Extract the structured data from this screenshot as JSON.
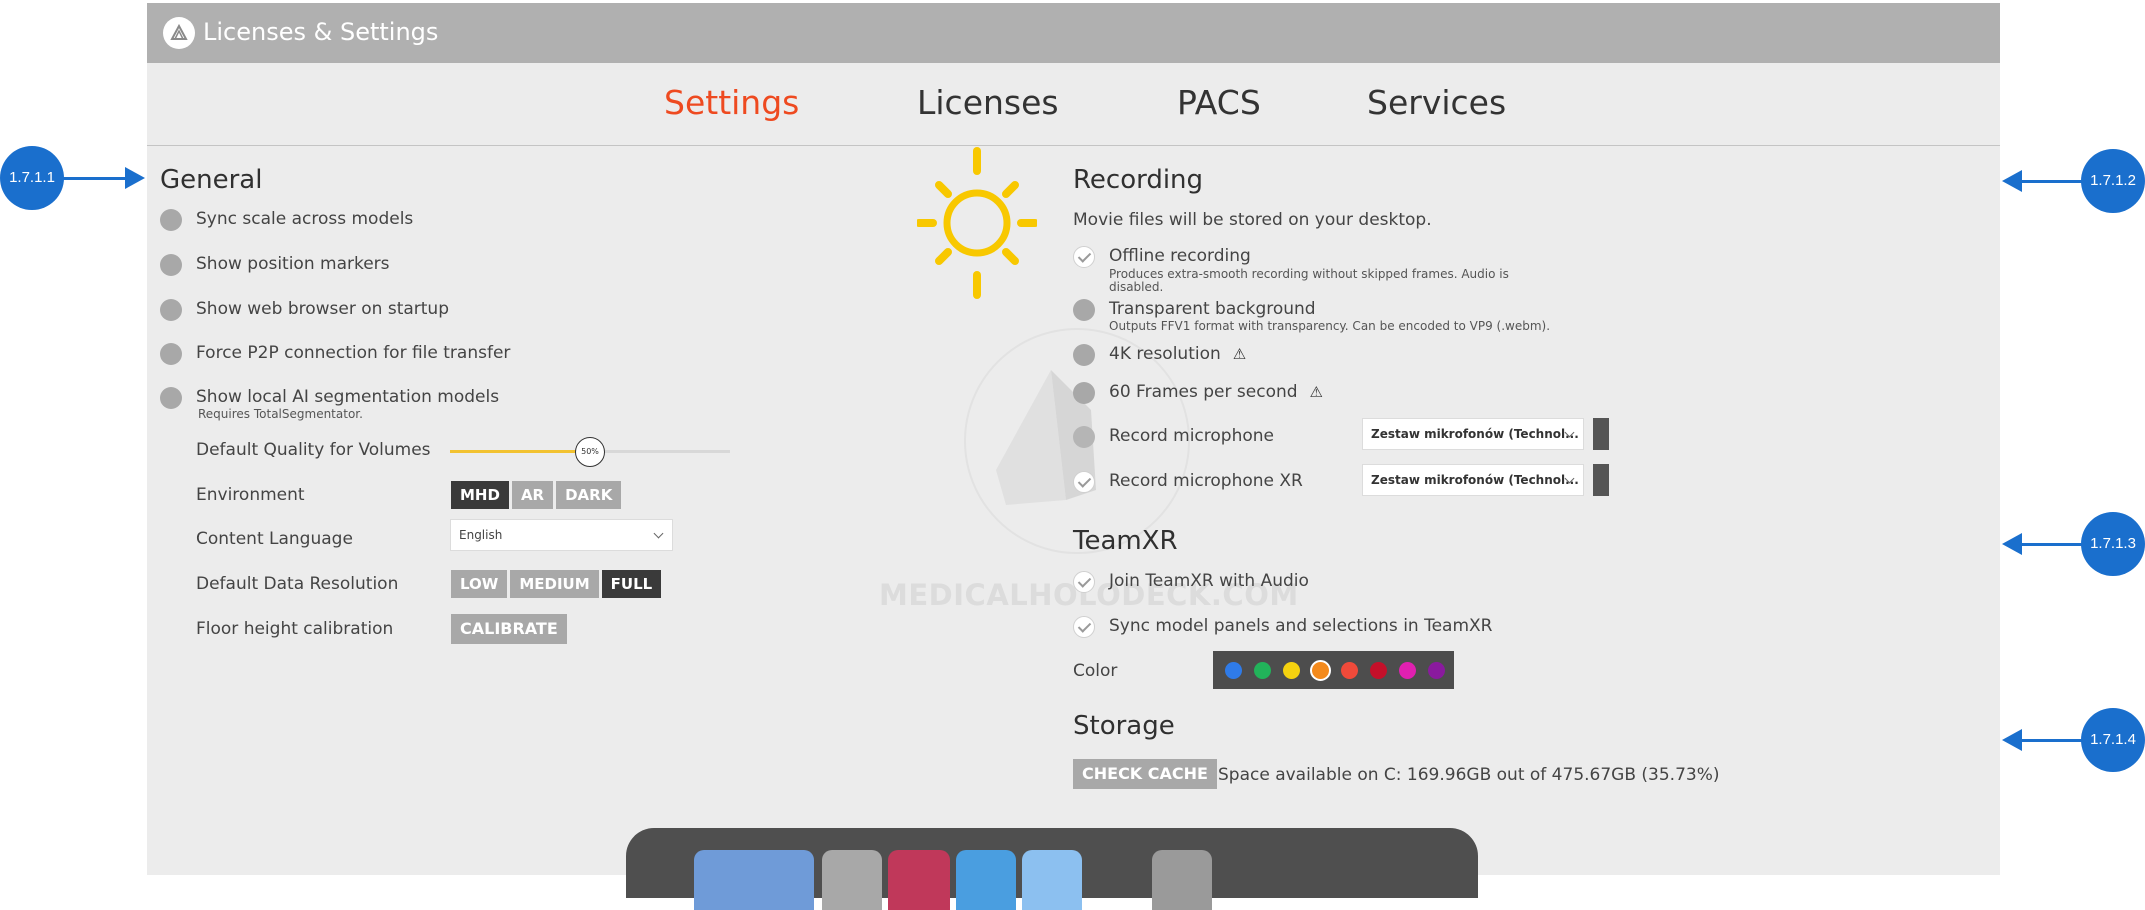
{
  "window": {
    "title": "Licenses & Settings",
    "logo_icon": "holodeck-logo-icon"
  },
  "tabs": [
    {
      "label": "Settings",
      "active": true
    },
    {
      "label": "Licenses",
      "active": false
    },
    {
      "label": "PACS",
      "active": false
    },
    {
      "label": "Services",
      "active": false
    }
  ],
  "general": {
    "title": "General",
    "toggles": [
      {
        "label": "Sync scale across models",
        "checked": false
      },
      {
        "label": "Show position markers",
        "checked": false
      },
      {
        "label": "Show web browser on startup",
        "checked": false
      },
      {
        "label": "Force P2P connection for file transfer",
        "checked": false
      },
      {
        "label": "Show local AI segmentation models",
        "sub": "Requires TotalSegmentator.",
        "checked": false
      }
    ],
    "quality": {
      "label": "Default Quality for Volumes",
      "value": 50,
      "value_text": "50%"
    },
    "environment": {
      "label": "Environment",
      "options": [
        "MHD",
        "AR",
        "DARK"
      ],
      "selected": "MHD"
    },
    "language": {
      "label": "Content Language",
      "value": "English"
    },
    "resolution": {
      "label": "Default Data Resolution",
      "options": [
        "LOW",
        "MEDIUM",
        "FULL"
      ],
      "selected": "FULL"
    },
    "floor": {
      "label": "Floor height calibration",
      "button": "CALIBRATE"
    }
  },
  "recording": {
    "title": "Recording",
    "subtitle": "Movie files will be stored on your desktop.",
    "offline": {
      "label": "Offline recording",
      "sub1": "Produces extra-smooth recording without skipped frames. Audio is",
      "sub2": "disabled.",
      "checked": true
    },
    "transparent": {
      "label": "Transparent background",
      "sub": "Outputs FFV1 format with transparency. Can be encoded to VP9 (.webm).",
      "checked": false
    },
    "res4k": {
      "label": "4K resolution",
      "warn": "⚠",
      "checked": false
    },
    "fps60": {
      "label": "60 Frames per second",
      "warn": "⚠",
      "checked": false
    },
    "mic": {
      "label": "Record microphone",
      "device": "Zestaw mikrofonów (Technol...",
      "checked": false
    },
    "micxr": {
      "label": "Record microphone XR",
      "device": "Zestaw mikrofonów (Technol...",
      "checked": true
    }
  },
  "teamxr": {
    "title": "TeamXR",
    "audio": {
      "label": "Join TeamXR with Audio",
      "checked": true
    },
    "sync": {
      "label": "Sync model panels and selections in TeamXR",
      "checked": true
    },
    "color": {
      "label": "Color",
      "swatches": [
        "#2f7be8",
        "#22b35a",
        "#f5d20f",
        "#f48a1c",
        "#f04a3a",
        "#c4102a",
        "#e020b0",
        "#8a1a9e"
      ],
      "selected_index": 3
    }
  },
  "storage": {
    "title": "Storage",
    "button": "CHECK CACHE",
    "status": "Space available on C: 169.96GB out of 475.67GB (35.73%)"
  },
  "watermark": {
    "text": "MEDICALHOLODECK.COM"
  },
  "callouts": {
    "general": "1.7.1.1",
    "recording": "1.7.1.2",
    "teamxr": "1.7.1.3",
    "storage": "1.7.1.4"
  },
  "colors": {
    "accent_tab": "#ee4a20",
    "callout": "#1a6fcd",
    "sun": "#f8c800",
    "slider": "#f2c230"
  }
}
